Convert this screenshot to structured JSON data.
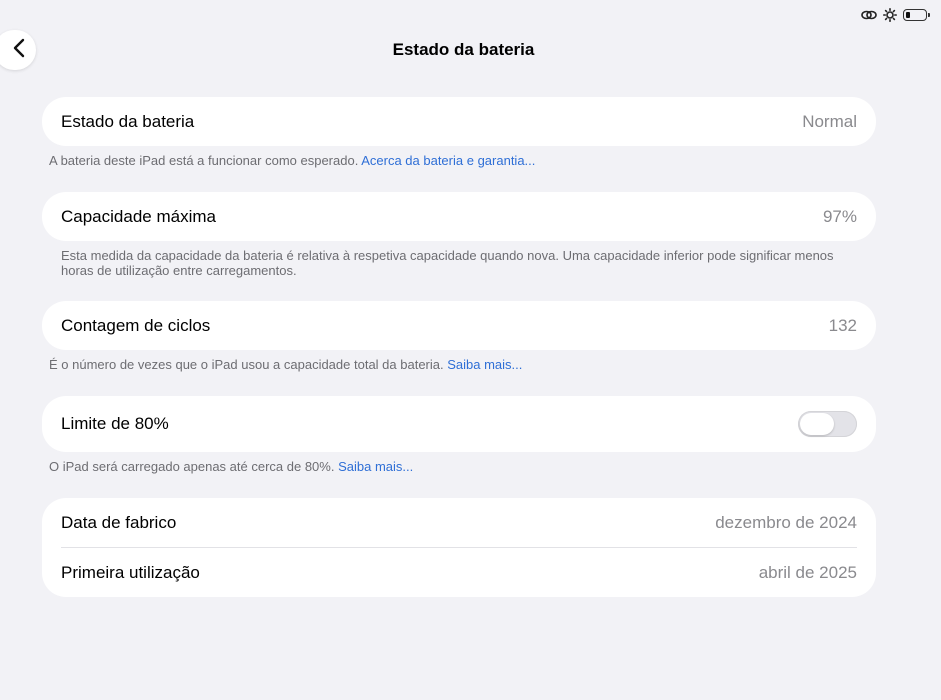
{
  "status_bar": {
    "icons": [
      "link-icon",
      "brightness-icon",
      "battery-icon"
    ]
  },
  "nav": {
    "title": "Estado da bateria",
    "back_icon": "chevron-left-icon"
  },
  "battery_state": {
    "label": "Estado da bateria",
    "value": "Normal",
    "footnote": "A bateria deste iPad está a funcionar como esperado.",
    "footnote_link": "Acerca da bateria e garantia..."
  },
  "max_capacity": {
    "label": "Capacidade máxima",
    "value": "97%",
    "footnote": "Esta medida da capacidade da bateria é relativa à respetiva capacidade quando nova. Uma capacidade inferior pode significar menos horas de utilização entre carregamentos."
  },
  "cycle_count": {
    "label": "Contagem de ciclos",
    "value": "132",
    "footnote": "É o número de vezes que o iPad usou a capacidade total da bateria.",
    "footnote_link": "Saiba mais..."
  },
  "limit_80": {
    "label": "Limite de 80%",
    "enabled": false,
    "footnote": "O iPad será carregado apenas até cerca de 80%.",
    "footnote_link": "Saiba mais..."
  },
  "dates": {
    "manufacture_label": "Data de fabrico",
    "manufacture_value": "dezembro de 2024",
    "first_use_label": "Primeira utilização",
    "first_use_value": "abril de 2025"
  },
  "colors": {
    "background": "#f2f2f6",
    "link": "#2f6fd6",
    "secondary_text": "#8a8a8e"
  }
}
